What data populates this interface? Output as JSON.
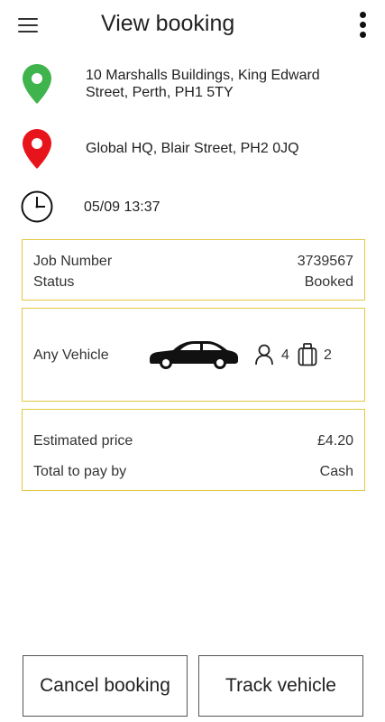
{
  "header": {
    "title": "View booking"
  },
  "pickup": {
    "address": "10 Marshalls Buildings, King Edward Street, Perth, PH1 5TY",
    "pin_color": "#3fb44c"
  },
  "dropoff": {
    "address": "Global HQ, Blair Street, PH2 0JQ",
    "pin_color": "#e8141b"
  },
  "time": {
    "value": "05/09 13:37"
  },
  "job": {
    "number_label": "Job Number",
    "number": "3739567",
    "status_label": "Status",
    "status": "Booked"
  },
  "vehicle": {
    "type": "Any Vehicle",
    "passengers": "4",
    "luggage": "2"
  },
  "price": {
    "estimated_label": "Estimated price",
    "estimated": "£4.20",
    "payment_label": "Total to pay by",
    "payment": "Cash"
  },
  "actions": {
    "cancel_label": "Cancel booking",
    "track_label": "Track vehicle"
  },
  "colors": {
    "card_border": "#e3c842"
  },
  "icons": {
    "menu": "hamburger-menu-icon",
    "more": "more-vertical-icon",
    "pickup": "map-pin-icon",
    "dropoff": "map-pin-icon",
    "time": "clock-icon",
    "car": "car-icon",
    "passengers": "person-icon",
    "luggage": "luggage-icon"
  }
}
